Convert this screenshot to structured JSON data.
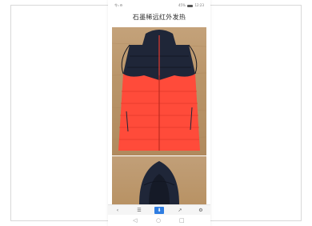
{
  "status_bar": {
    "left_text": "令ᵢₗ ⚙",
    "right_text": "45%",
    "time": "12:23"
  },
  "title": "石墨稀远红外发热",
  "bottom_nav": [
    {
      "icon": "back-icon",
      "glyph": "‹"
    },
    {
      "icon": "menu-icon",
      "glyph": "☰"
    },
    {
      "icon": "download-icon",
      "glyph": "⬇"
    },
    {
      "icon": "share-icon",
      "glyph": "↗"
    },
    {
      "icon": "settings-icon",
      "glyph": "⚙"
    }
  ],
  "system_nav": [
    {
      "icon": "back-triangle-icon",
      "glyph": "◁"
    },
    {
      "icon": "home-circle-icon",
      "glyph": "○"
    },
    {
      "icon": "recent-square-icon",
      "glyph": "□"
    }
  ],
  "colors": {
    "vest_top": "#1f2638",
    "vest_bottom": "#ff4b3a",
    "zipper": "#e23a2e",
    "wood": "#bd9a70",
    "accent": "#2f7de1"
  }
}
